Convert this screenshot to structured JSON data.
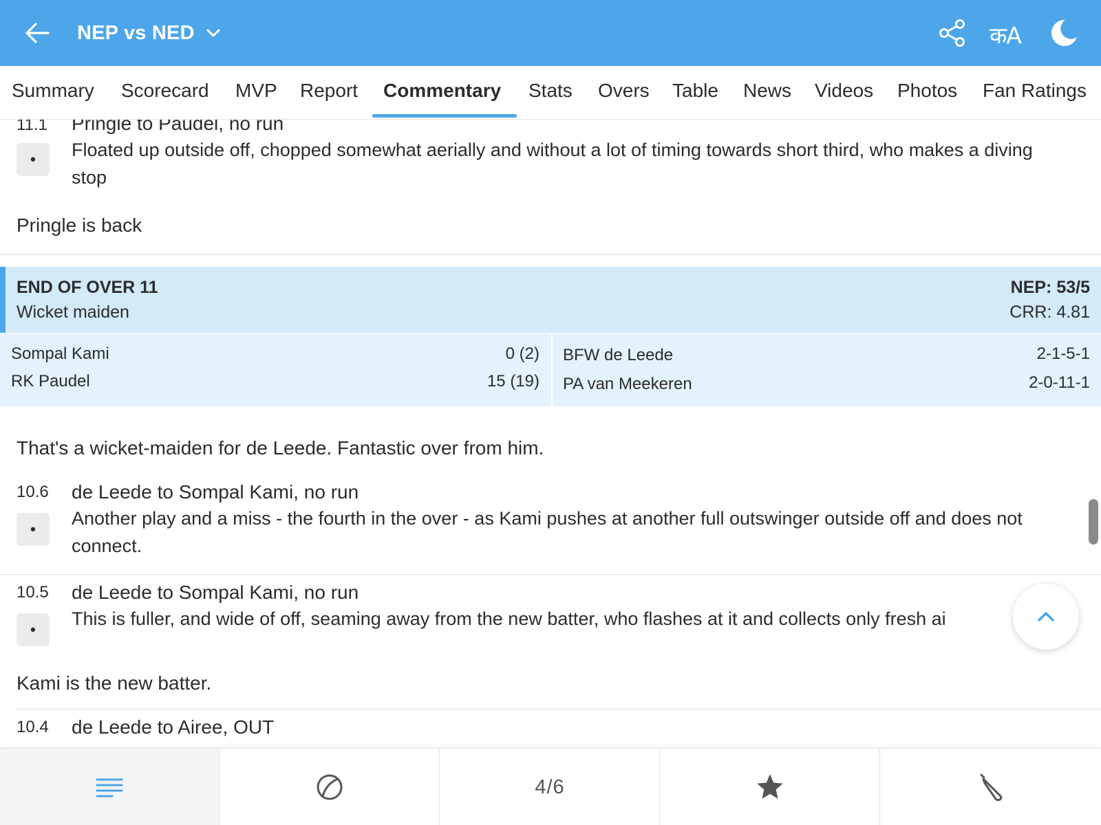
{
  "header": {
    "title": "NEP vs NED",
    "lang_label": "कA",
    "bg_color": "#4da6ea",
    "icons": [
      "back-arrow-icon",
      "chevron-down-icon",
      "share-icon",
      "language-icon",
      "moon-icon"
    ]
  },
  "tabs": [
    {
      "label": "Summary"
    },
    {
      "label": "Scorecard"
    },
    {
      "label": "MVP"
    },
    {
      "label": "Report"
    },
    {
      "label": "Commentary",
      "active": true
    },
    {
      "label": "Stats"
    },
    {
      "label": "Overs"
    },
    {
      "label": "Table"
    },
    {
      "label": "News"
    },
    {
      "label": "Videos"
    },
    {
      "label": "Photos"
    },
    {
      "label": "Fan Ratings"
    }
  ],
  "commentary": {
    "ball_11_1": {
      "over": "11.1",
      "headline": "Pringle to Paudel, no run",
      "result": "•",
      "text": "Floated up outside off, chopped somewhat aerially and without a lot of timing towards short third, who makes a diving stop"
    },
    "note_pringle": "Pringle is back",
    "end_of_over": {
      "title": "END OF OVER 11",
      "subtitle": "Wicket maiden",
      "score": "NEP: 53/5",
      "crr": "CRR: 4.81",
      "batters": [
        {
          "name": "Sompal Kami",
          "figures": "0 (2)"
        },
        {
          "name": "RK Paudel",
          "figures": "15 (19)"
        }
      ],
      "bowlers": [
        {
          "name": "BFW de Leede",
          "figures": "2-1-5-1"
        },
        {
          "name": "PA van Meekeren",
          "figures": "2-0-11-1"
        }
      ]
    },
    "note_maiden": "That's a wicket-maiden for de Leede. Fantastic over from him.",
    "ball_10_6": {
      "over": "10.6",
      "headline": "de Leede to Sompal Kami, no run",
      "result": "•",
      "text": "Another play and a miss - the fourth in the over - as Kami pushes at another full outswinger outside off and does not connect."
    },
    "ball_10_5": {
      "over": "10.5",
      "headline": "de Leede to Sompal Kami, no run",
      "result": "•",
      "text": "This is fuller, and wide of off, seaming away from the new batter, who flashes at it and collects only fresh ai"
    },
    "note_kami": "Kami is the new batter.",
    "ball_10_4": {
      "over": "10.4",
      "headline": "de Leede to Airee, OUT"
    }
  },
  "bottom_bar": {
    "items": [
      "menu-icon",
      "ball-icon",
      "page-count",
      "star-icon",
      "bat-icon"
    ],
    "page_count": "4/6",
    "accent_color": "#4da6ea"
  }
}
